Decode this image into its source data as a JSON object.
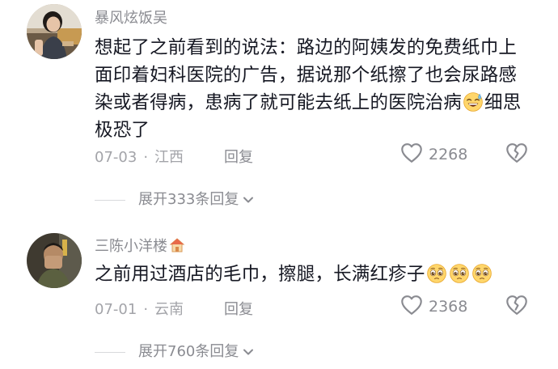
{
  "comments": [
    {
      "username": "暴风炫饭吴",
      "text_line1": "想起了之前看到的说法：路边的阿姨发的免费纸巾上",
      "text_line2": "面印着妇科医院的广告，据说那个纸擦了也会尿路感",
      "text_line3": "染或者得病，患病了就可能去纸上的医院治病",
      "text_line4_after_emoji": "细思",
      "text_line5": "极恐了",
      "emoji_1": "sweat-smile-emoji",
      "date": "07-03",
      "location": "江西",
      "reply_label": "回复",
      "likes": "2268",
      "expand_label": "展开333条回复"
    },
    {
      "username": "三陈小洋楼",
      "username_badge": "house-emoji",
      "text": "之前用过酒店的毛巾，擦腿，长满红疹子",
      "emojis": [
        "pleading-face-emoji",
        "pleading-face-emoji",
        "pleading-face-emoji"
      ],
      "date": "07-01",
      "location": "云南",
      "reply_label": "回复",
      "likes": "2368",
      "expand_label": "展开760条回复"
    }
  ],
  "colors": {
    "text": "#161823",
    "secondary": "#8a8b91",
    "meta": "#a3a4a9"
  }
}
